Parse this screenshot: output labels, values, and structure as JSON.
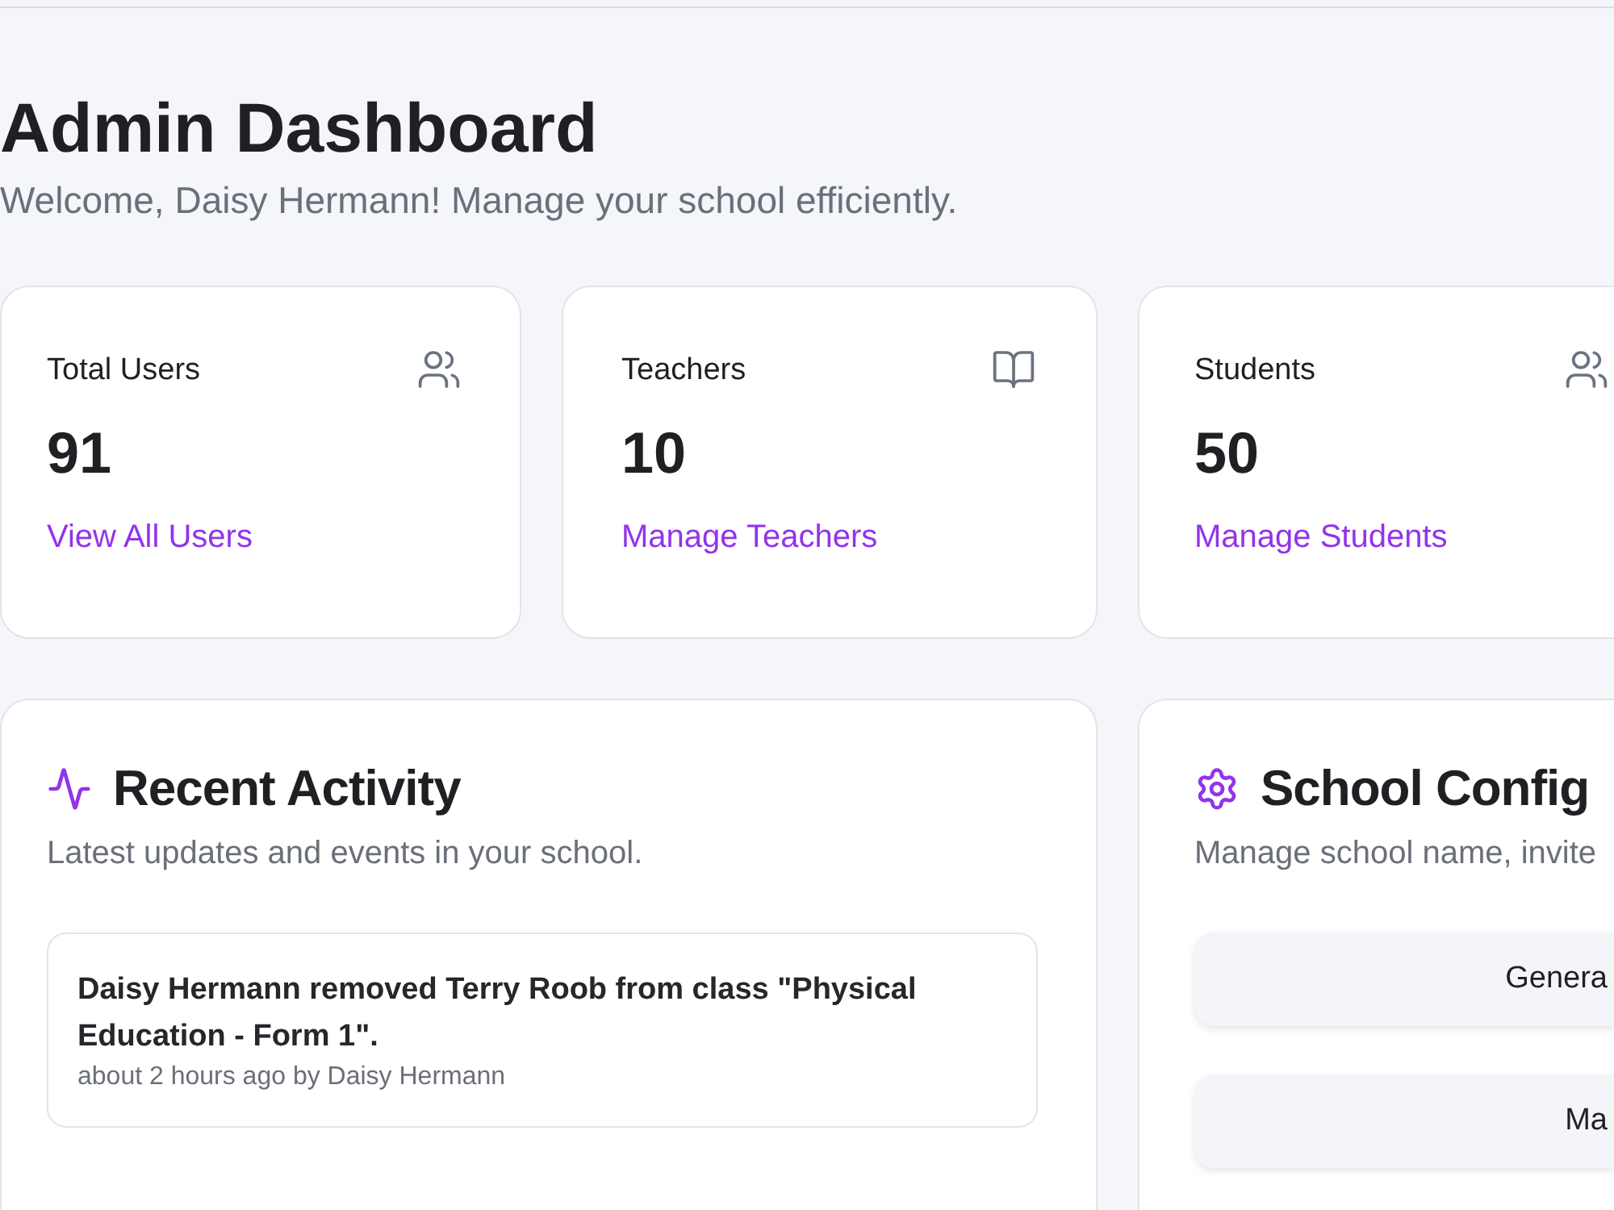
{
  "page": {
    "title": "Admin Dashboard",
    "subtitle": "Welcome, Daisy Hermann! Manage your school efficiently."
  },
  "stats": [
    {
      "label": "Total Users",
      "value": "91",
      "link": "View All Users"
    },
    {
      "label": "Teachers",
      "value": "10",
      "link": "Manage Teachers"
    },
    {
      "label": "Students",
      "value": "50",
      "link": "Manage Students"
    }
  ],
  "recent_activity": {
    "title": "Recent Activity",
    "subtitle": "Latest updates and events in your school.",
    "items": [
      {
        "text": "Daisy Hermann removed Terry Roob from class \"Physical Education - Form 1\".",
        "meta": "about 2 hours ago by Daisy Hermann"
      }
    ]
  },
  "school_configuration": {
    "title": "School Config",
    "subtitle": "Manage school name, invite",
    "buttons": [
      "Genera",
      "Ma"
    ]
  }
}
